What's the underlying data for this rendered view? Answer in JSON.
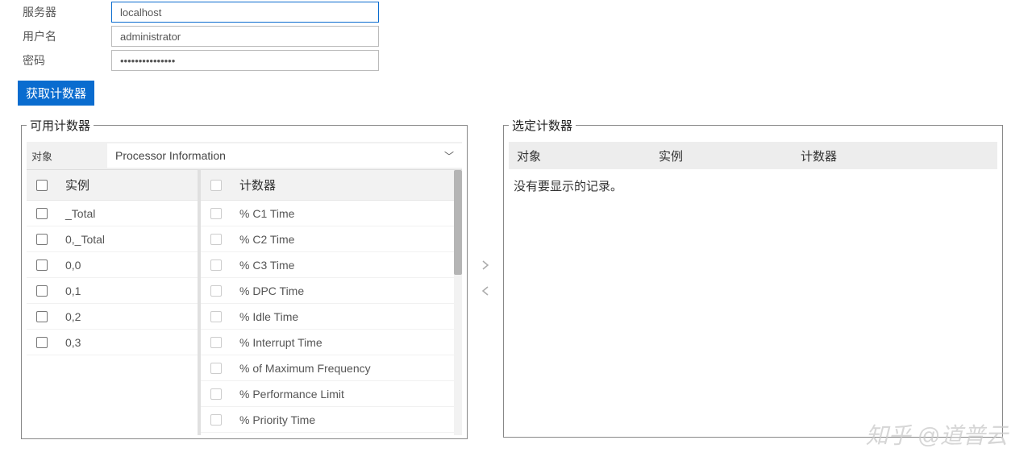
{
  "form": {
    "server_label": "服务器",
    "server_value": "localhost",
    "user_label": "用户名",
    "user_value": "administrator",
    "pwd_label": "密码",
    "pwd_value": "•••••••••••••••"
  },
  "actions": {
    "fetch_label": "获取计数器"
  },
  "available": {
    "legend": "可用计数器",
    "object_label": "对象",
    "object_selected": "Processor Information",
    "instance_header": "实例",
    "counter_header": "计数器",
    "instances": [
      "_Total",
      "0,_Total",
      "0,0",
      "0,1",
      "0,2",
      "0,3"
    ],
    "counters": [
      "% C1 Time",
      "% C2 Time",
      "% C3 Time",
      "% DPC Time",
      "% Idle Time",
      "% Interrupt Time",
      "% of Maximum Frequency",
      "% Performance Limit",
      "% Priority Time"
    ]
  },
  "selected": {
    "legend": "选定计数器",
    "col_object": "对象",
    "col_instance": "实例",
    "col_counter": "计数器",
    "empty": "没有要显示的记录。"
  },
  "watermark": "知乎 @道普云"
}
